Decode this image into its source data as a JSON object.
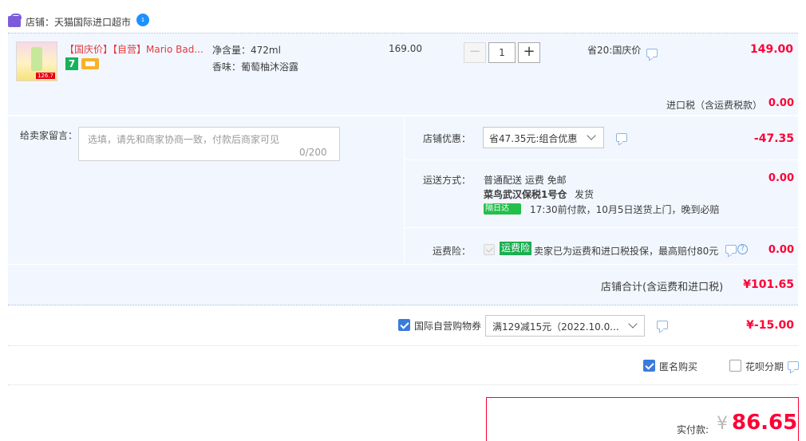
{
  "shop": {
    "label": "店铺：天猫国际进口超市",
    "ww_badge": "1"
  },
  "item": {
    "title": "【国庆价】【自营】Mario Bad...",
    "thumb_price": "126.7",
    "badge_num": "7",
    "sku_capacity": "净含量：472ml",
    "sku_flavor": "香味：葡萄柚沐浴露",
    "unit_price": "169.00",
    "quantity": "1",
    "qty_minus": "−",
    "qty_plus": "+",
    "promo": "省20:国庆价",
    "total": "149.00"
  },
  "tax": {
    "label": "进口税（含运费税款）",
    "value": "0.00"
  },
  "message": {
    "label": "给卖家留言：",
    "placeholder": "选填，请先和商家协商一致，付款后商家可见",
    "count": "0/200"
  },
  "shop_discount": {
    "label": "店铺优惠：",
    "selected": "省47.35元:组合优惠",
    "value": "-47.35"
  },
  "shipping": {
    "label": "运送方式：",
    "line1": "普通配送 运费 免邮",
    "line2_bold": "菜鸟武汉保税1号仓",
    "line2_rest": "发货",
    "nextday_tag": "隔日达",
    "line3": "17:30前付款，10月5日送货上门，晚到必赔",
    "value": "0.00"
  },
  "insurance": {
    "label": "运费险：",
    "tag": "运费险",
    "text": "卖家已为运费和进口税投保，最高赔付80元",
    "value": "0.00"
  },
  "subtotal": {
    "label": "店铺合计(含运费和进口税)",
    "value": "¥101.65"
  },
  "coupon": {
    "label": "国际自营购物券",
    "selected": "满129减15元（2022.10.0...",
    "value": "¥-15.00"
  },
  "options": {
    "anonymous": "匿名购买",
    "huabei": "花呗分期"
  },
  "total": {
    "label": "实付款:",
    "yen": "¥",
    "value": "86.65"
  },
  "colors": {
    "price_red": "#ff0036",
    "panel_blue": "#f2f7ff",
    "checkbox_blue": "#3a7bdc",
    "green_tag": "#1aaf51"
  }
}
